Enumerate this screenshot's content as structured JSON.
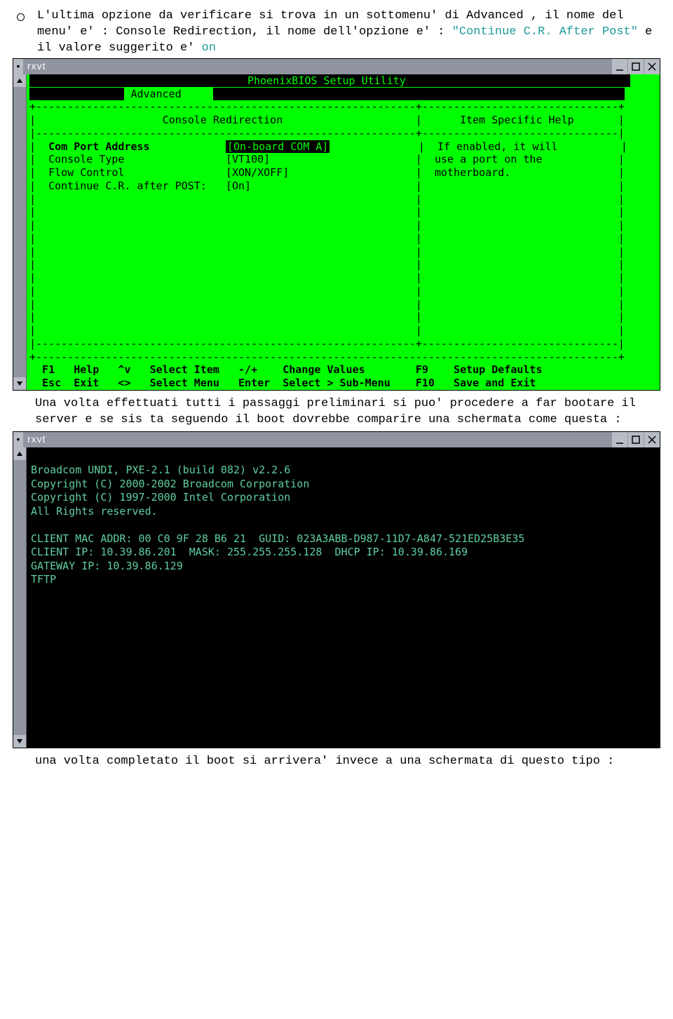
{
  "intro": {
    "line1": "L'ultima opzione da verificare si trova in un sottomenu' di Advanced , il nome del menu' e' : Console Redirection, il nome dell'opzione e' : ",
    "opt": "\"Continue C.R. After Post\"",
    "line2": " e il valore suggerito e' ",
    "val": "on"
  },
  "win": {
    "title": "rxvt"
  },
  "bios": {
    "title": "PhoenixBIOS Setup Utility",
    "advanced": "Advanced",
    "panel_left": "Console Redirection",
    "panel_right": "Item Specific Help",
    "rows": [
      {
        "label": "Com Port Address",
        "value": "On-board COM A",
        "sel": true
      },
      {
        "label": "Console Type",
        "value": "VT100"
      },
      {
        "label": "Flow Control",
        "value": "XON/XOFF"
      },
      {
        "label": "Continue C.R. after POST:",
        "value": "On"
      }
    ],
    "help": [
      "If enabled, it will",
      "use a port on the",
      "motherboard."
    ],
    "footer1": "F1   Help   ^v   Select Item   -/+    Change Values        F9    Setup Defaults",
    "footer2": "Esc  Exit   <>   Select Menu   Enter  Select > Sub-Menu    F10   Save and Exit"
  },
  "mid": "Una volta effettuati tutti i passaggi preliminari si puo' procedere a far bootare il server e se sis ta seguendo il boot dovrebbe comparire una schermata come questa :",
  "pxe": [
    "Broadcom UNDI, PXE-2.1 (build 082) v2.2.6",
    "Copyright (C) 2000-2002 Broadcom Corporation",
    "Copyright (C) 1997-2000 Intel Corporation",
    "All Rights reserved.",
    "",
    "CLIENT MAC ADDR: 00 C0 9F 28 B6 21  GUID: 023A3ABB-D987-11D7-A847-521ED25B3E35",
    "CLIENT IP: 10.39.86.201  MASK: 255.255.255.128  DHCP IP: 10.39.86.169",
    "GATEWAY IP: 10.39.86.129",
    "TFTP"
  ],
  "outro": "una volta completato il boot si arrivera' invece a una schermata di questo tipo :"
}
